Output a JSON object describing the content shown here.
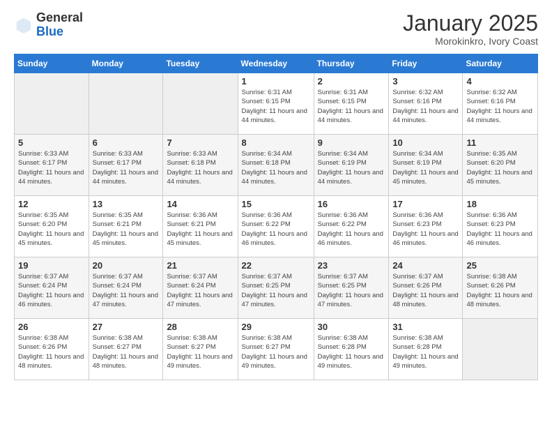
{
  "header": {
    "logo_general": "General",
    "logo_blue": "Blue",
    "month": "January 2025",
    "location": "Morokinkro, Ivory Coast"
  },
  "days_of_week": [
    "Sunday",
    "Monday",
    "Tuesday",
    "Wednesday",
    "Thursday",
    "Friday",
    "Saturday"
  ],
  "weeks": [
    [
      {
        "day": "",
        "empty": true
      },
      {
        "day": "",
        "empty": true
      },
      {
        "day": "",
        "empty": true
      },
      {
        "day": "1",
        "sunrise": "Sunrise: 6:31 AM",
        "sunset": "Sunset: 6:15 PM",
        "daylight": "Daylight: 11 hours and 44 minutes."
      },
      {
        "day": "2",
        "sunrise": "Sunrise: 6:31 AM",
        "sunset": "Sunset: 6:15 PM",
        "daylight": "Daylight: 11 hours and 44 minutes."
      },
      {
        "day": "3",
        "sunrise": "Sunrise: 6:32 AM",
        "sunset": "Sunset: 6:16 PM",
        "daylight": "Daylight: 11 hours and 44 minutes."
      },
      {
        "day": "4",
        "sunrise": "Sunrise: 6:32 AM",
        "sunset": "Sunset: 6:16 PM",
        "daylight": "Daylight: 11 hours and 44 minutes."
      }
    ],
    [
      {
        "day": "5",
        "sunrise": "Sunrise: 6:33 AM",
        "sunset": "Sunset: 6:17 PM",
        "daylight": "Daylight: 11 hours and 44 minutes."
      },
      {
        "day": "6",
        "sunrise": "Sunrise: 6:33 AM",
        "sunset": "Sunset: 6:17 PM",
        "daylight": "Daylight: 11 hours and 44 minutes."
      },
      {
        "day": "7",
        "sunrise": "Sunrise: 6:33 AM",
        "sunset": "Sunset: 6:18 PM",
        "daylight": "Daylight: 11 hours and 44 minutes."
      },
      {
        "day": "8",
        "sunrise": "Sunrise: 6:34 AM",
        "sunset": "Sunset: 6:18 PM",
        "daylight": "Daylight: 11 hours and 44 minutes."
      },
      {
        "day": "9",
        "sunrise": "Sunrise: 6:34 AM",
        "sunset": "Sunset: 6:19 PM",
        "daylight": "Daylight: 11 hours and 44 minutes."
      },
      {
        "day": "10",
        "sunrise": "Sunrise: 6:34 AM",
        "sunset": "Sunset: 6:19 PM",
        "daylight": "Daylight: 11 hours and 45 minutes."
      },
      {
        "day": "11",
        "sunrise": "Sunrise: 6:35 AM",
        "sunset": "Sunset: 6:20 PM",
        "daylight": "Daylight: 11 hours and 45 minutes."
      }
    ],
    [
      {
        "day": "12",
        "sunrise": "Sunrise: 6:35 AM",
        "sunset": "Sunset: 6:20 PM",
        "daylight": "Daylight: 11 hours and 45 minutes."
      },
      {
        "day": "13",
        "sunrise": "Sunrise: 6:35 AM",
        "sunset": "Sunset: 6:21 PM",
        "daylight": "Daylight: 11 hours and 45 minutes."
      },
      {
        "day": "14",
        "sunrise": "Sunrise: 6:36 AM",
        "sunset": "Sunset: 6:21 PM",
        "daylight": "Daylight: 11 hours and 45 minutes."
      },
      {
        "day": "15",
        "sunrise": "Sunrise: 6:36 AM",
        "sunset": "Sunset: 6:22 PM",
        "daylight": "Daylight: 11 hours and 46 minutes."
      },
      {
        "day": "16",
        "sunrise": "Sunrise: 6:36 AM",
        "sunset": "Sunset: 6:22 PM",
        "daylight": "Daylight: 11 hours and 46 minutes."
      },
      {
        "day": "17",
        "sunrise": "Sunrise: 6:36 AM",
        "sunset": "Sunset: 6:23 PM",
        "daylight": "Daylight: 11 hours and 46 minutes."
      },
      {
        "day": "18",
        "sunrise": "Sunrise: 6:36 AM",
        "sunset": "Sunset: 6:23 PM",
        "daylight": "Daylight: 11 hours and 46 minutes."
      }
    ],
    [
      {
        "day": "19",
        "sunrise": "Sunrise: 6:37 AM",
        "sunset": "Sunset: 6:24 PM",
        "daylight": "Daylight: 11 hours and 46 minutes."
      },
      {
        "day": "20",
        "sunrise": "Sunrise: 6:37 AM",
        "sunset": "Sunset: 6:24 PM",
        "daylight": "Daylight: 11 hours and 47 minutes."
      },
      {
        "day": "21",
        "sunrise": "Sunrise: 6:37 AM",
        "sunset": "Sunset: 6:24 PM",
        "daylight": "Daylight: 11 hours and 47 minutes."
      },
      {
        "day": "22",
        "sunrise": "Sunrise: 6:37 AM",
        "sunset": "Sunset: 6:25 PM",
        "daylight": "Daylight: 11 hours and 47 minutes."
      },
      {
        "day": "23",
        "sunrise": "Sunrise: 6:37 AM",
        "sunset": "Sunset: 6:25 PM",
        "daylight": "Daylight: 11 hours and 47 minutes."
      },
      {
        "day": "24",
        "sunrise": "Sunrise: 6:37 AM",
        "sunset": "Sunset: 6:26 PM",
        "daylight": "Daylight: 11 hours and 48 minutes."
      },
      {
        "day": "25",
        "sunrise": "Sunrise: 6:38 AM",
        "sunset": "Sunset: 6:26 PM",
        "daylight": "Daylight: 11 hours and 48 minutes."
      }
    ],
    [
      {
        "day": "26",
        "sunrise": "Sunrise: 6:38 AM",
        "sunset": "Sunset: 6:26 PM",
        "daylight": "Daylight: 11 hours and 48 minutes."
      },
      {
        "day": "27",
        "sunrise": "Sunrise: 6:38 AM",
        "sunset": "Sunset: 6:27 PM",
        "daylight": "Daylight: 11 hours and 48 minutes."
      },
      {
        "day": "28",
        "sunrise": "Sunrise: 6:38 AM",
        "sunset": "Sunset: 6:27 PM",
        "daylight": "Daylight: 11 hours and 49 minutes."
      },
      {
        "day": "29",
        "sunrise": "Sunrise: 6:38 AM",
        "sunset": "Sunset: 6:27 PM",
        "daylight": "Daylight: 11 hours and 49 minutes."
      },
      {
        "day": "30",
        "sunrise": "Sunrise: 6:38 AM",
        "sunset": "Sunset: 6:28 PM",
        "daylight": "Daylight: 11 hours and 49 minutes."
      },
      {
        "day": "31",
        "sunrise": "Sunrise: 6:38 AM",
        "sunset": "Sunset: 6:28 PM",
        "daylight": "Daylight: 11 hours and 49 minutes."
      },
      {
        "day": "",
        "empty": true
      }
    ]
  ]
}
